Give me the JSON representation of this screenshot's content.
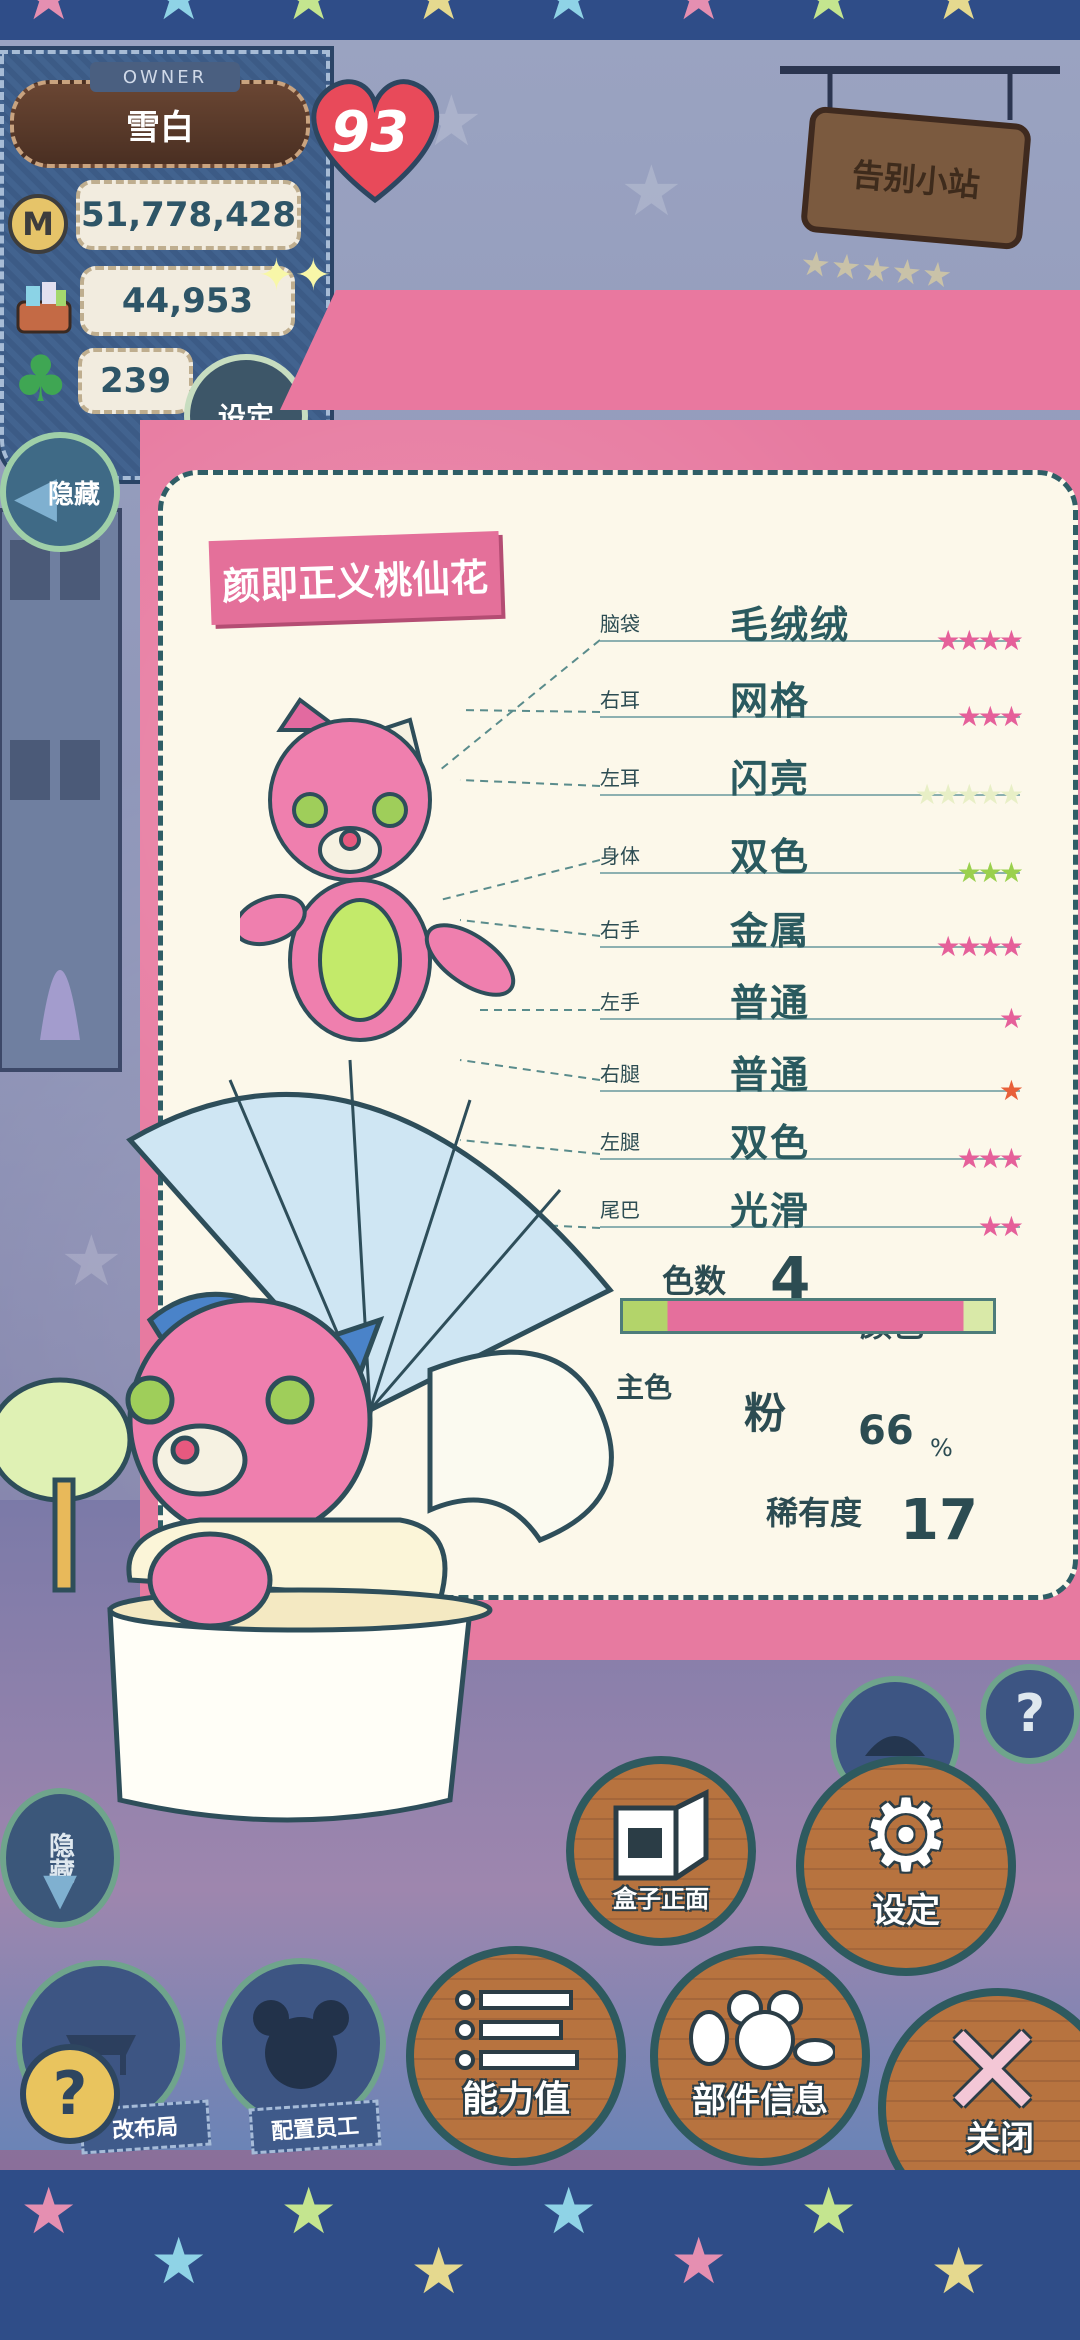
{
  "owner": {
    "tag": "OWNER",
    "name": "雪白",
    "coins": "51,778,428",
    "materials": "44,953",
    "clovers": "239",
    "level": "93"
  },
  "buttons": {
    "settings_top": "设定",
    "hide_top": "隐藏",
    "hide_left": "隐藏",
    "box_front": "盒子正面",
    "settings": "设定",
    "stats": "能力值",
    "parts_info": "部件信息",
    "close": "关闭",
    "layout": "改布局",
    "staff": "配置员工",
    "help": "?"
  },
  "sign": "告别小站",
  "card": {
    "title": "颜即正义桃仙花",
    "parts": [
      {
        "label": "脑袋",
        "value": "毛绒绒",
        "stars": "★★★★"
      },
      {
        "label": "右耳",
        "value": "网格",
        "stars": "★★★"
      },
      {
        "label": "左耳",
        "value": "闪亮",
        "stars": "★★★★★"
      },
      {
        "label": "身体",
        "value": "双色",
        "stars": "★★★"
      },
      {
        "label": "右手",
        "value": "金属",
        "stars": "★★★★"
      },
      {
        "label": "左手",
        "value": "普通",
        "stars": "★"
      },
      {
        "label": "右腿",
        "value": "普通",
        "stars": "★"
      },
      {
        "label": "左腿",
        "value": "双色",
        "stars": "★★★"
      },
      {
        "label": "尾巴",
        "value": "光滑",
        "stars": "★★"
      }
    ],
    "color_count_label": "色数",
    "color_count": "4",
    "color_label": "颜色",
    "main_color_label": "主色",
    "main_color": "粉",
    "main_color_pct": "66",
    "pct_unit": "%",
    "rarity_label": "稀有度",
    "rarity": "17"
  },
  "colors": {
    "pink": "#e77aa0",
    "teal": "#2f5e66",
    "brick": "#b7733f"
  }
}
